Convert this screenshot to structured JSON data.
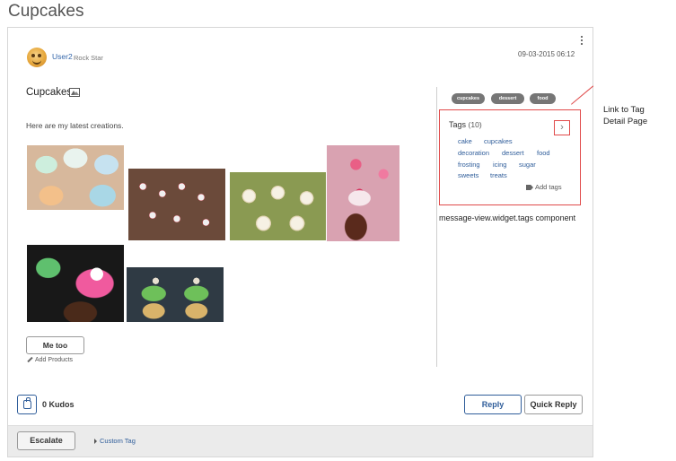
{
  "page": {
    "title": "Cupcakes"
  },
  "author": {
    "name": "User2",
    "rank": "Rock Star",
    "date": "09-03-2015 06:12"
  },
  "message": {
    "subject": "Cupcakes",
    "body": "Here are my latest creations.",
    "me_too_label": "Me too",
    "add_products_label": "Add Products"
  },
  "pills": [
    "cupcakes",
    "dessert",
    "food"
  ],
  "tags": {
    "title": "Tags",
    "count": "(10)",
    "items": [
      "cake",
      "cupcakes",
      "decoration",
      "dessert",
      "food",
      "frosting",
      "icing",
      "sugar",
      "sweets",
      "treats"
    ],
    "add_label": "Add tags",
    "detail_glyph": "›"
  },
  "annotations": {
    "component_label": "message-view.widget.tags component",
    "callout_line1": "Link to Tag",
    "callout_line2": "Detail Page"
  },
  "kudos": {
    "count_label": "0 Kudos"
  },
  "actions": {
    "reply": "Reply",
    "quick_reply": "Quick Reply",
    "escalate": "Escalate",
    "custom_tag": "Custom Tag"
  },
  "icons": [
    "kebab-menu-icon",
    "image-icon",
    "pencil-icon",
    "tag-icon",
    "thumbs-up-icon",
    "caret-right-icon"
  ],
  "colors": {
    "link": "#2f5d9a",
    "annotation_red": "#e04a4a",
    "pill_gray": "#767676"
  }
}
